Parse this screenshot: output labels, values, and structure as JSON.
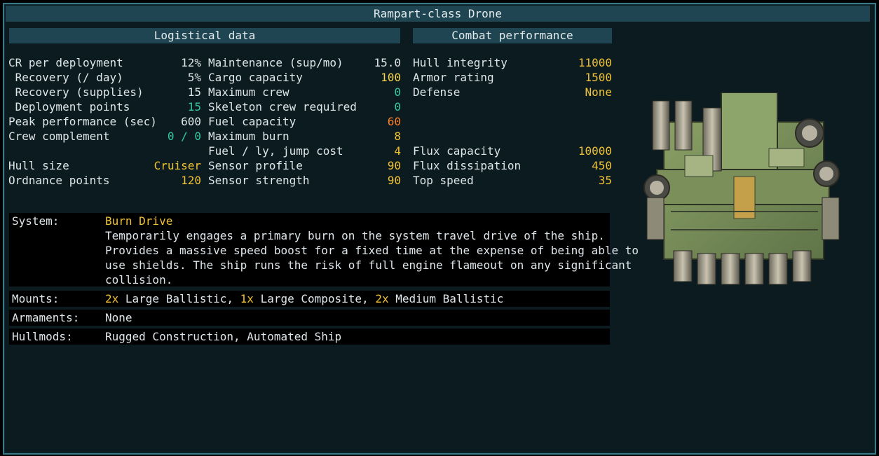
{
  "title": "Rampart-class Drone",
  "logistical": {
    "header": "Logistical data",
    "col1": [
      {
        "label": "CR per deployment",
        "value": "12%",
        "color": "w"
      },
      {
        "label": " Recovery (/ day)",
        "value": "5%",
        "color": "w"
      },
      {
        "label": " Recovery (supplies)",
        "value": "15",
        "color": "w"
      },
      {
        "label": " Deployment points",
        "value": "15",
        "color": "c"
      },
      {
        "label": "Peak performance (sec)",
        "value": "600",
        "color": "w"
      },
      {
        "label": "Crew complement",
        "value": "0 / 0",
        "color": "c"
      },
      {
        "label": "",
        "value": "",
        "color": "w"
      },
      {
        "label": "Hull size",
        "value": "Cruiser",
        "color": "y"
      },
      {
        "label": "Ordnance points",
        "value": "120",
        "color": "y"
      }
    ],
    "col2": [
      {
        "label": "Maintenance (sup/mo)",
        "value": "15.0",
        "color": "w"
      },
      {
        "label": "Cargo capacity",
        "value": "100",
        "color": "yl"
      },
      {
        "label": "Maximum crew",
        "value": "0",
        "color": "c"
      },
      {
        "label": "Skeleton crew required",
        "value": "0",
        "color": "c"
      },
      {
        "label": "Fuel capacity",
        "value": "60",
        "color": "o"
      },
      {
        "label": "Maximum burn",
        "value": "8",
        "color": "y"
      },
      {
        "label": "Fuel / ly, jump cost",
        "value": "4",
        "color": "y"
      },
      {
        "label": "Sensor profile",
        "value": "90",
        "color": "y"
      },
      {
        "label": "Sensor strength",
        "value": "90",
        "color": "y"
      }
    ]
  },
  "combat": {
    "header": "Combat performance",
    "rows": [
      {
        "label": "Hull integrity",
        "value": "11000",
        "color": "y"
      },
      {
        "label": "Armor rating",
        "value": "1500",
        "color": "y"
      },
      {
        "label": "Defense",
        "value": "None",
        "color": "y"
      },
      {
        "label": "",
        "value": "",
        "color": "w"
      },
      {
        "label": "",
        "value": "",
        "color": "w"
      },
      {
        "label": "",
        "value": "",
        "color": "w"
      },
      {
        "label": "Flux capacity",
        "value": "10000",
        "color": "y"
      },
      {
        "label": "Flux dissipation",
        "value": "450",
        "color": "y"
      },
      {
        "label": "Top speed",
        "value": "35",
        "color": "y"
      }
    ]
  },
  "system": {
    "label": "System:",
    "name": "Burn Drive",
    "lines": [
      "Temporarily engages a primary burn on the system travel drive of the ship.",
      "Provides a massive speed boost for a fixed time at the expense of being able to",
      "use shields. The ship runs the risk of full engine flameout on any significant",
      "collision."
    ]
  },
  "mounts": {
    "label": "Mounts:",
    "items": [
      {
        "count": "2x",
        "name": " Large Ballistic,"
      },
      {
        "count": "1x",
        "name": " Large Composite,"
      },
      {
        "count": "2x",
        "name": " Medium Ballistic"
      }
    ]
  },
  "armaments": {
    "label": "Armaments:",
    "value": "None"
  },
  "hullmods": {
    "label": "Hullmods:",
    "value": "Rugged Construction, Automated Ship"
  },
  "colors": {
    "panel_bg": "#0b1b20",
    "header_bg": "#1e4551",
    "highlight": "#f1c232",
    "teal": "#35c8a4",
    "orange": "#ff7f27"
  }
}
